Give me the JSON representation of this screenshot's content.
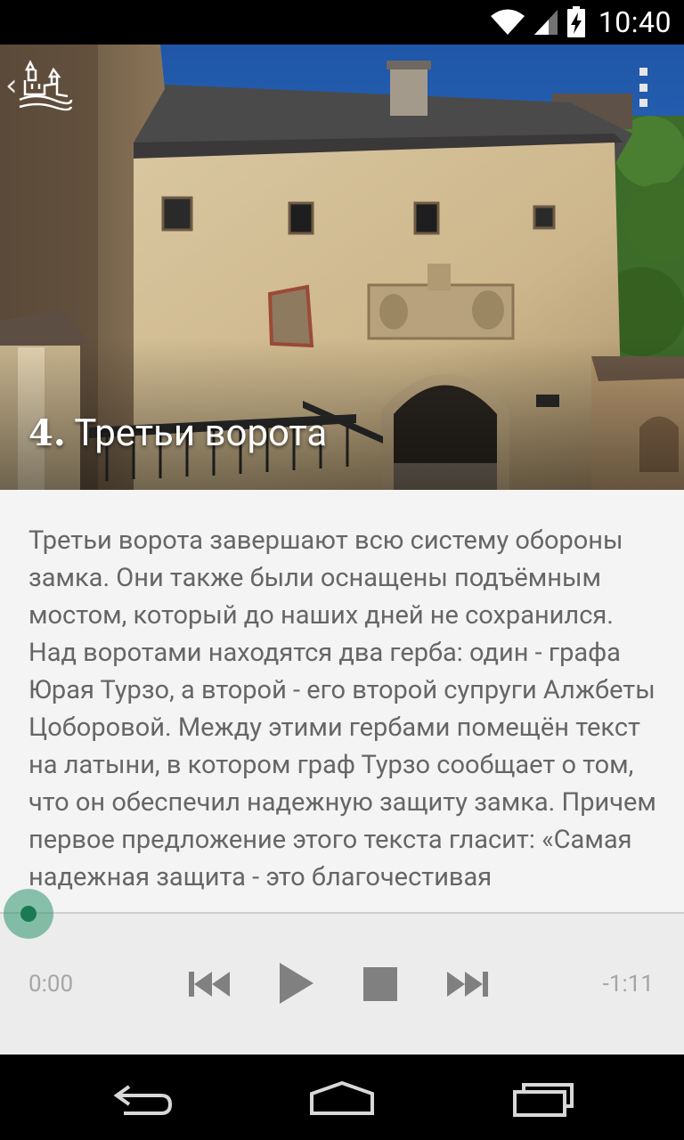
{
  "status_bar": {
    "time": "10:40",
    "icons": [
      "wifi-icon",
      "cell-signal-icon",
      "battery-charging-icon"
    ]
  },
  "header": {
    "back_icon": "chevron-left-icon",
    "logo": "castle-logo-icon",
    "menu_icon": "overflow-menu-icon"
  },
  "chapter": {
    "number": "4.",
    "title": "Третьи ворота"
  },
  "description": "Третьи ворота завершают всю систему обороны замка. Они также были оснащены подъёмным мостом, который до наших дней не сохранился. Над воротами находятся два герба: один - графа Юрая Турзо, а второй - его второй супруги Алжбеты Цоборовой. Между этими гербами помещён текст на латыни, в котором граф Турзо сообщает о том, что он обеспечил надежную защиту замка. Причем первое предложение этого текста гласит: «Самая надежная защита - это благочестивая",
  "player": {
    "elapsed": "0:00",
    "remaining": "-1:11",
    "progress": 0,
    "controls": [
      "skip-previous-icon",
      "play-icon",
      "stop-icon",
      "skip-next-icon"
    ],
    "accent_color": "#1a7a52"
  },
  "nav_bar": {
    "buttons": [
      "back-icon",
      "home-icon",
      "recent-apps-icon"
    ]
  }
}
